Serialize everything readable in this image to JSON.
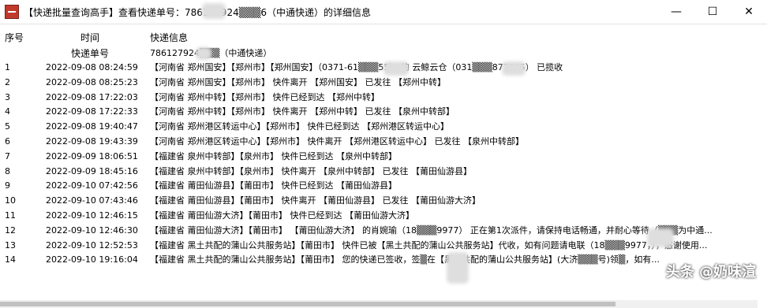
{
  "window": {
    "title": "【快递批量查询高手】查看快递单号：786127924▒▒▒6（中通快递）的详细信息",
    "minimize": "—",
    "maximize": "☐",
    "close": "✕"
  },
  "table": {
    "header_no": "序号",
    "header_time": "时间",
    "header_info": "快递信息",
    "sub_tracking_label": "快递单号",
    "sub_tracking_value": "786127924▒▒▒（中通快递）",
    "rows": [
      {
        "no": "1",
        "time": "2022-09-08 08:24:59",
        "info": "【河南省 郑州国安】【郑州市】【郑州国安】（0371-61▒▒▒55） 的 云鲸云仓（031▒▒▒877635） 已揽收"
      },
      {
        "no": "2",
        "time": "2022-09-08 08:25:23",
        "info": "【河南省 郑州国安】【郑州市】 快件离开 【郑州国安】 已发往 【郑州中转】"
      },
      {
        "no": "3",
        "time": "2022-09-08 17:22:03",
        "info": "【河南省 郑州中转】【郑州市】 快件已经到达 【郑州中转】"
      },
      {
        "no": "4",
        "time": "2022-09-08 17:22:33",
        "info": "【河南省 郑州中转】【郑州市】 快件离开 【郑州中转】 已发往 【泉州中转部】"
      },
      {
        "no": "5",
        "time": "2022-09-08 19:40:47",
        "info": "【河南省 郑州港区转运中心】【郑州市】 快件已经到达 【郑州港区转运中心】"
      },
      {
        "no": "6",
        "time": "2022-09-08 19:43:39",
        "info": "【河南省 郑州港区转运中心】【郑州市】 快件离开 【郑州港区转运中心】 已发往 【泉州中转部】"
      },
      {
        "no": "7",
        "time": "2022-09-09 18:06:51",
        "info": "【福建省 泉州中转部】【泉州市】 快件已经到达 【泉州中转部】"
      },
      {
        "no": "8",
        "time": "2022-09-09 18:45:16",
        "info": "【福建省 泉州中转部】【泉州市】 快件离开 【泉州中转部】 已发往 【莆田仙游县】"
      },
      {
        "no": "9",
        "time": "2022-09-10 07:42:56",
        "info": "【福建省 莆田仙游县】【莆田市】 快件已经到达 【莆田仙游县】"
      },
      {
        "no": "10",
        "time": "2022-09-10 07:43:46",
        "info": "【福建省 莆田仙游县】【莆田市】 快件离开 【莆田仙游县】 已发往 【莆田仙游大济】"
      },
      {
        "no": "11",
        "time": "2022-09-10 12:46:15",
        "info": "【福建省 莆田仙游大济】【莆田市】 快件已经到达 【莆田仙游大济】"
      },
      {
        "no": "12",
        "time": "2022-09-10 12:46:30",
        "info": "【福建省 莆田仙游大济】【莆田市】 【莆田仙游大济】 的肖婉瑜（18▒▒▒9977） 正在第1次派件，请保持电话畅通，并耐心等待（▒▒▒为中通..."
      },
      {
        "no": "13",
        "time": "2022-09-10 12:52:53",
        "info": "【福建省 黑土共配的蒲山公共服务站】【莆田市】 快件已被【黑土共配的蒲山公共服务站】代收，如有问题请电联（18▒▒▒9977，），感谢使用..."
      },
      {
        "no": "14",
        "time": "2022-09-10 19:16:04",
        "info": "【福建省 黑土共配的蒲山公共服务站】【莆田市】 您的快递已签收，签▒在【黑土共配的蒲山公共服务站】(大济▒▒▒号)领▒，如有..."
      }
    ]
  },
  "watermark": "头条 @奶味渲"
}
